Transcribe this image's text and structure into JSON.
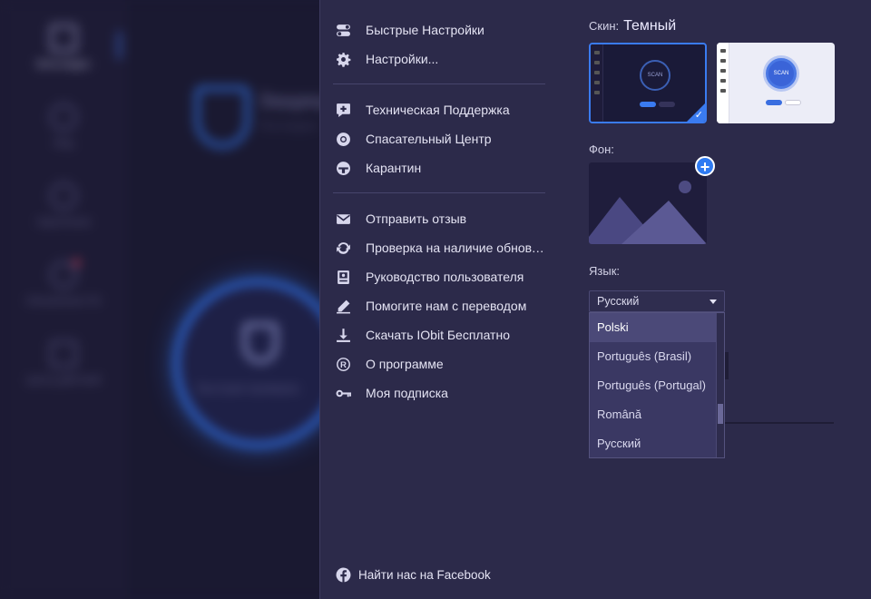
{
  "background_app": {
    "sidebar": [
      {
        "label": "Волк-видео",
        "icon": "shield-icon",
        "active": true
      },
      {
        "label": "Мод",
        "icon": "globe-icon",
        "active": false
      },
      {
        "label": "Укрепление",
        "icon": "gauge-icon",
        "active": false
      },
      {
        "label": "Обновление ПО",
        "icon": "update-icon",
        "active": false,
        "badge": true
      },
      {
        "label": "Центр действий",
        "icon": "grid-icon",
        "active": false
      }
    ],
    "title": "Защищ",
    "subtitle": "Последни",
    "scan_label": "Быстрая проверка"
  },
  "menu": {
    "group1": [
      {
        "label": "Быстрые Настройки",
        "icon": "toggle-icon"
      },
      {
        "label": "Настройки...",
        "icon": "gear-icon"
      }
    ],
    "group2": [
      {
        "label": "Техническая Поддержка",
        "icon": "support-icon"
      },
      {
        "label": "Спасательный Центр",
        "icon": "lifebuoy-icon"
      },
      {
        "label": "Карантин",
        "icon": "quarantine-icon"
      }
    ],
    "group3": [
      {
        "label": "Отправить отзыв",
        "icon": "mail-icon"
      },
      {
        "label": "Проверка на наличие обновлений",
        "icon": "refresh-icon"
      },
      {
        "label": "Руководство пользователя",
        "icon": "book-icon"
      },
      {
        "label": "Помогите нам с переводом",
        "icon": "pencil-icon"
      },
      {
        "label": "Скачать IObit Бесплатно",
        "icon": "download-icon"
      },
      {
        "label": "О программе",
        "icon": "registered-icon"
      },
      {
        "label": "Моя подписка",
        "icon": "key-icon"
      }
    ],
    "facebook": {
      "label": "Найти нас на Facebook",
      "icon": "facebook-icon"
    }
  },
  "settings": {
    "skin_label": "Скин:",
    "skin_value": "Темный",
    "skins": [
      {
        "name": "Dark",
        "selected": true,
        "scan": "SCAN"
      },
      {
        "name": "Light",
        "selected": false,
        "scan": "SCAN"
      }
    ],
    "background_label": "Фон:",
    "add_icon": "+",
    "language_label": "Язык:",
    "language_selected": "Русский",
    "language_options": [
      "Polski",
      "Português (Brasil)",
      "Português (Portugal)",
      "Română",
      "Русский"
    ],
    "hovered_option": "Polski"
  },
  "colors": {
    "accent": "#3a7bf0",
    "panel": "#2c2a4a",
    "dropdown": "#3a3863"
  }
}
